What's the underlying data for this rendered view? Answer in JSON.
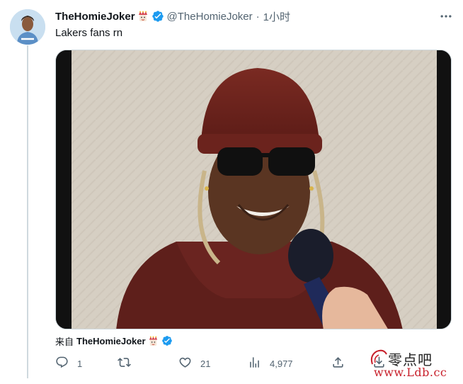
{
  "tweet": {
    "display_name": "TheHomieJoker",
    "handle": "@TheHomieJoker",
    "separator": "·",
    "time": "1小时",
    "text": "Lakers fans rn",
    "source_prefix": "来自",
    "source_name": "TheHomieJoker"
  },
  "actions": {
    "replies": "1",
    "retweets": "",
    "likes": "21",
    "views": "4,977"
  },
  "icons": [
    "avatar",
    "joker-emoji-icon",
    "verified-badge-icon",
    "more-icon",
    "reply-icon",
    "retweet-icon",
    "like-icon",
    "views-icon",
    "share-icon",
    "bookmark-icon"
  ],
  "colors": {
    "verified": "#1d9bf0",
    "secondary_text": "#536471",
    "primary_text": "#0f1419",
    "watermark_red": "#c8202b"
  },
  "watermark": {
    "top": "零点吧",
    "bottom": "www.Ldb.cc"
  }
}
